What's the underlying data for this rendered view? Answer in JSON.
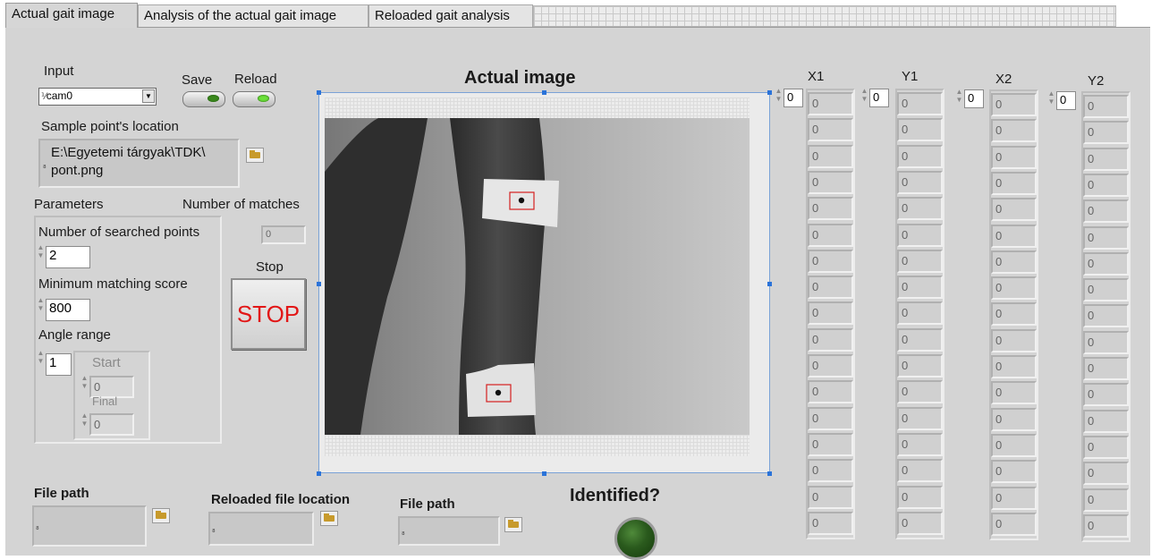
{
  "tabs": [
    {
      "label": "Actual gait image",
      "active": true
    },
    {
      "label": "Analysis of the actual gait image",
      "active": false
    },
    {
      "label": "Reloaded gait analysis",
      "active": false
    }
  ],
  "input": {
    "label": "Input",
    "camera": "cam0",
    "save_label": "Save",
    "reload_label": "Reload"
  },
  "sample": {
    "label": "Sample point's location",
    "path_line1": "E:\\Egyetemi tárgyak\\TDK\\",
    "path_line2": "pont.png"
  },
  "parameters": {
    "label": "Parameters",
    "matches_label": "Number of matches",
    "matches_value": "0",
    "searched_label": "Number of searched points",
    "searched_value": "2",
    "score_label": "Minimum matching score",
    "score_value": "800",
    "angle_label": "Angle range",
    "angle_value": "1",
    "start_label": "Start",
    "start_value": "0",
    "final_label": "Final",
    "final_value": "0"
  },
  "stop": {
    "label": "Stop",
    "button": "STOP"
  },
  "image": {
    "title": "Actual image"
  },
  "identified": {
    "label": "Identified?",
    "lit": false
  },
  "files": {
    "file_path_label": "File path",
    "reloaded_label": "Reloaded file location",
    "file_path2_label": "File path"
  },
  "columns": [
    {
      "header": "X1",
      "control": "0",
      "values": [
        "0",
        "0",
        "0",
        "0",
        "0",
        "0",
        "0",
        "0",
        "0",
        "0",
        "0",
        "0",
        "0",
        "0",
        "0",
        "0",
        "0"
      ]
    },
    {
      "header": "Y1",
      "control": "0",
      "values": [
        "0",
        "0",
        "0",
        "0",
        "0",
        "0",
        "0",
        "0",
        "0",
        "0",
        "0",
        "0",
        "0",
        "0",
        "0",
        "0",
        "0"
      ]
    },
    {
      "header": "X2",
      "control": "0",
      "values": [
        "0",
        "0",
        "0",
        "0",
        "0",
        "0",
        "0",
        "0",
        "0",
        "0",
        "0",
        "0",
        "0",
        "0",
        "0",
        "0",
        "0"
      ]
    },
    {
      "header": "Y2",
      "control": "0",
      "values": [
        "0",
        "0",
        "0",
        "0",
        "0",
        "0",
        "0",
        "0",
        "0",
        "0",
        "0",
        "0",
        "0",
        "0",
        "0",
        "0",
        "0"
      ]
    }
  ],
  "colors": {
    "panel": "#d4d4d4",
    "stop_text": "#e21717",
    "led_green": "#6ce13a",
    "marker_red": "#d42020"
  }
}
